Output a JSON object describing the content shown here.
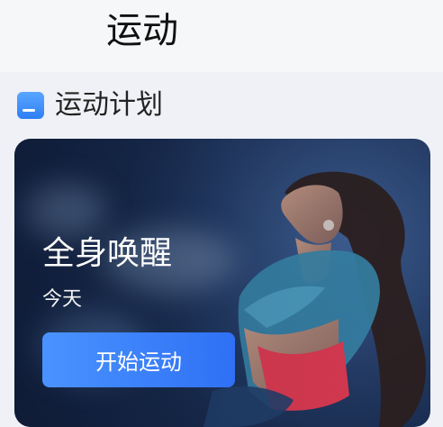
{
  "header": {
    "title": "运动"
  },
  "section": {
    "title": "运动计划",
    "icon": "plan-icon"
  },
  "plan_card": {
    "title": "全身唤醒",
    "subtitle": "今天",
    "start_button": "开始运动",
    "image": "woman-stretching-photo"
  },
  "colors": {
    "accent": "#2f7ff6",
    "button_start": "#4a93ff",
    "button_end": "#2f70f5"
  }
}
